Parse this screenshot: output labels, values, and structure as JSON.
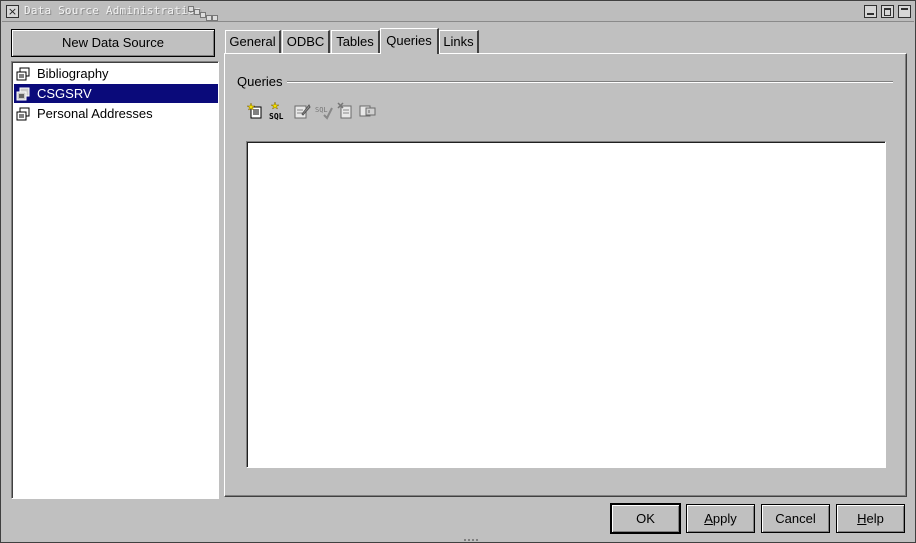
{
  "window": {
    "title": "Data Source Administration"
  },
  "left": {
    "new_button_label": "New Data Source",
    "data_sources": [
      {
        "label": "Bibliography",
        "selected": false
      },
      {
        "label": "CSGSRV",
        "selected": true
      },
      {
        "label": "Personal Addresses",
        "selected": false
      }
    ]
  },
  "tabs": [
    {
      "label": "General",
      "active": false
    },
    {
      "label": "ODBC",
      "active": false
    },
    {
      "label": "Tables",
      "active": false
    },
    {
      "label": "Queries",
      "active": true
    },
    {
      "label": "Links",
      "active": false
    }
  ],
  "queries_panel": {
    "group_label": "Queries",
    "toolbar": {
      "sql_label": "SQL",
      "icons": [
        "new-query-icon",
        "new-sql-query-icon",
        "edit-query-icon",
        "sql-check-icon",
        "delete-query-icon",
        "rename-query-icon"
      ]
    }
  },
  "buttons": {
    "ok": "OK",
    "apply_hotkey": "A",
    "apply_rest": "pply",
    "cancel": "Cancel",
    "help_hotkey": "H",
    "help_rest": "elp"
  },
  "colors": {
    "window_bg": "#c0c0c0",
    "selection_bg": "#0a0a7a",
    "list_bg": "#ffffff"
  }
}
